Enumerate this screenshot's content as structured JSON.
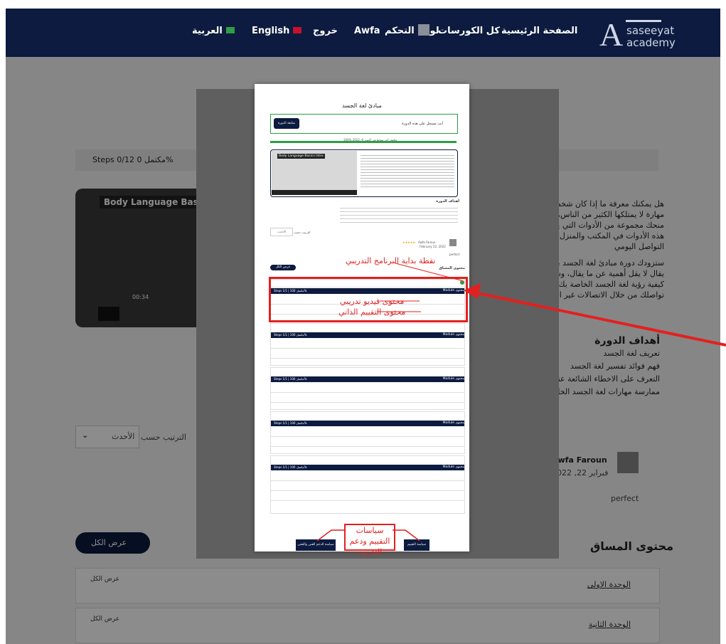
{
  "nav": {
    "logo_line1": "saseeyat",
    "logo_line2": "academy",
    "home": "الصفحة الرئيسية",
    "courses": "كل الكورسات",
    "dashboard": "لوحة التحكم",
    "user": "Awfa",
    "logout": "خروج",
    "english": "English",
    "arabic": "العربية"
  },
  "background": {
    "steps_text": "Steps 0/12 مكتمل 0%",
    "video_title": "Body Language Basics Intro",
    "video_time": "00:34",
    "desc_line1": "هل يمكنك معرفة ما إذا كان شخص ما يقول الحقيقة",
    "desc_line2": "مهارة لا يمتلكها الكثير من الناس، من خلال دورة مبادئ",
    "desc_line3": "منحك مجموعة من الأدوات التي يمكنك استخدامها",
    "desc_line4": "هذه الأدوات في المكتب والمنزل، سيوفر لك فهم لغة",
    "desc_line5": "التواصل اليومي",
    "desc2_line1": "ستزودك دورة مبادئ لغة الجسد بمجموعة رائعة من",
    "desc2_line2": "يقال لا يقل أهمية عن ما يقال، وسوف يمنحك أيضا",
    "desc2_line3": "كيفية رؤية لغة الجسد الخاصة بك، ستكون قادرا على",
    "desc2_line4": "تواصلك من خلال الاتصالات غير اللفظية",
    "goals_title": "أهداف الدورة",
    "goal1": "تعريف لغة الجسد",
    "goal2": "فهم فوائد تفسير لغة الجسد",
    "goal3": "التعرف على الاخطاء الشائعة عند تفسير لغة الجسد",
    "goal4": "ممارسة مهارات لغة الجسد الخاصة بك",
    "sort_label": "الترتيب حسب",
    "sort_value": "الأحدث",
    "reviewer": "Awfa Faroun",
    "review_date": "فبراير 22, 2022",
    "review_text": "perfect",
    "show_all": "عرض الكل",
    "content_title": "محتوى المساق",
    "unit1": "الوحدة الاولى",
    "unit2": "الوحدة الثانية",
    "expand_label": "عرض الكل"
  },
  "modal": {
    "title": "مبادئ لغة الجسد",
    "enrolled": "أنت مسجل على هذه الدورة",
    "continue_btn": "متابعة الدورة",
    "progress_text": "100% مكتمل آخر نشاط في أكتوبر 6, 2022",
    "video_title": "Body Language Basics Intro",
    "goals_title": "أهداف الدورة",
    "sort_label": "الترتيب حسب",
    "sort_value": "الأحدث",
    "reviewer": "Awfa Faroun",
    "review_date": "February 22, 2022",
    "review_text": "perfect",
    "content_title": "محتوى المساق",
    "show_all": "عرض الكل",
    "module_label": "Module محتوى",
    "steps_label": "Steps 1/1 | مكتمل 100%",
    "foot_left": "سياسة الدعم الفني والتقني",
    "foot_right": "سياسة التقييم"
  },
  "annotations": {
    "start_point": "نقطة بداية البرنامج التدريبي",
    "video_content": "محتوى فيديو تدريبي",
    "self_assessment": "محتوى التقييم الذاتي",
    "policies": "سياسات التقييم ودعم التدريب"
  },
  "colors": {
    "navy": "#0c1b3f",
    "accent_red": "#e32020",
    "green": "#2e9e44"
  }
}
